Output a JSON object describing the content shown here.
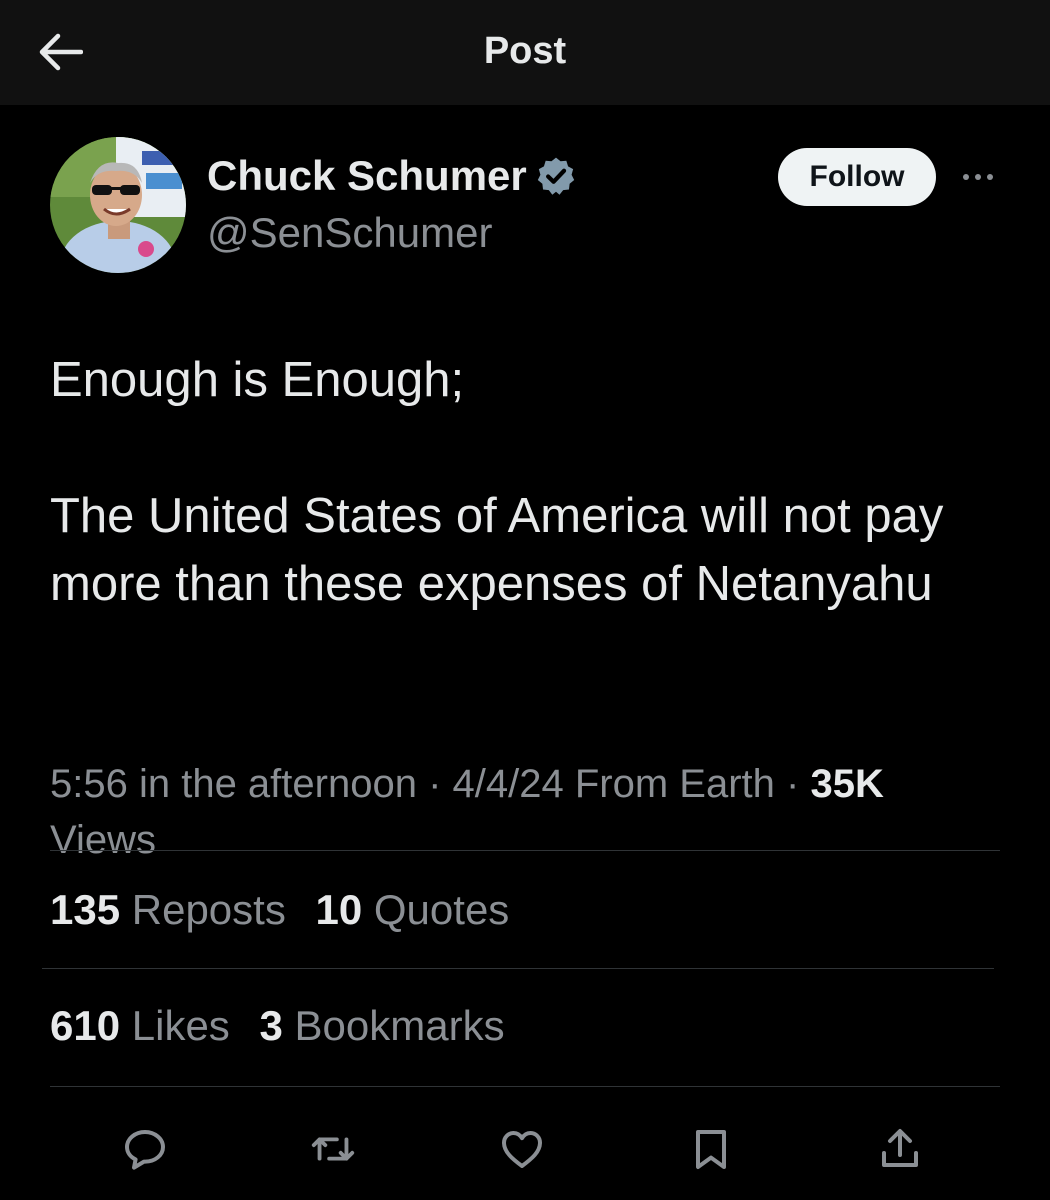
{
  "header": {
    "title": "Post"
  },
  "author": {
    "name": "Chuck Schumer",
    "handle": "@SenSchumer",
    "verified": true,
    "verified_color": "#829aab"
  },
  "follow_label": "Follow",
  "post": {
    "line1": "Enough is Enough;",
    "line2": "The United States of America will not pay more than these expenses of Netanyahu"
  },
  "meta": {
    "time": "5:56 in the afternoon",
    "date": "4/4/24",
    "source": "From Earth",
    "views_count": "35K",
    "views_label": "Views"
  },
  "stats": {
    "reposts_count": "135",
    "reposts_label": "Reposts",
    "quotes_count": "10",
    "quotes_label": "Quotes",
    "likes_count": "610",
    "likes_label": "Likes",
    "bookmarks_count": "3",
    "bookmarks_label": "Bookmarks"
  },
  "actions": [
    "reply-icon",
    "repost-icon",
    "like-icon",
    "bookmark-icon",
    "share-icon"
  ],
  "colors": {
    "background": "#000000",
    "header_bg": "#111111",
    "text": "#e7e9ea",
    "secondary_text": "#8b8f94",
    "divider": "#2f3336"
  }
}
